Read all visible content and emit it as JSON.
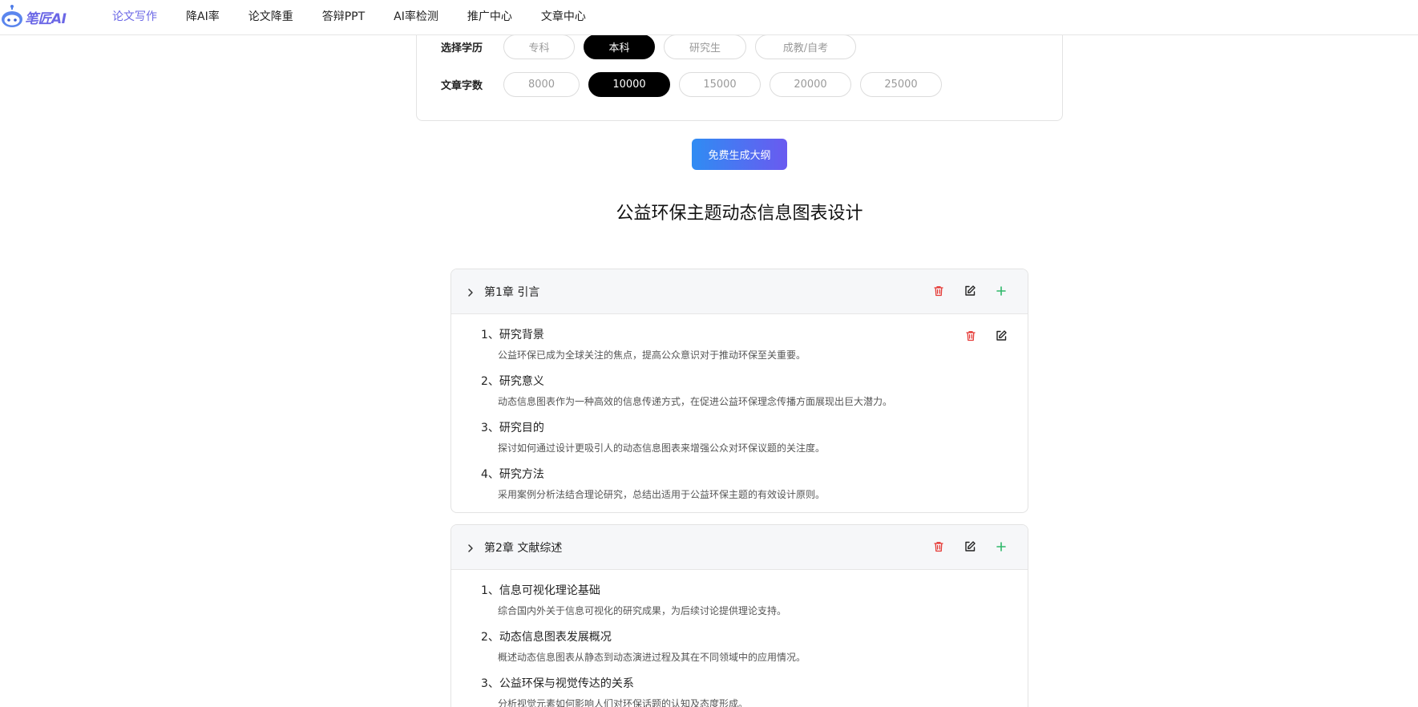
{
  "brand": {
    "name": "笔匠AI"
  },
  "nav": {
    "items": [
      {
        "label": "论文写作",
        "active": true
      },
      {
        "label": "降AI率",
        "active": false
      },
      {
        "label": "论文降重",
        "active": false
      },
      {
        "label": "答辩PPT",
        "active": false
      },
      {
        "label": "AI率检测",
        "active": false
      },
      {
        "label": "推广中心",
        "active": false
      },
      {
        "label": "文章中心",
        "active": false
      }
    ]
  },
  "options": {
    "education": {
      "label": "选择学历",
      "choices": [
        "专科",
        "本科",
        "研究生",
        "成教/自考"
      ],
      "selected": "本科"
    },
    "word_count": {
      "label": "文章字数",
      "choices": [
        "8000",
        "10000",
        "15000",
        "20000",
        "25000"
      ],
      "selected": "10000"
    }
  },
  "generate_button": {
    "label": "免费生成大纲"
  },
  "outline": {
    "title": "公益环保主题动态信息图表设计",
    "chapters": [
      {
        "title": "第1章 引言",
        "sections": [
          {
            "title": "1、研究背景",
            "desc": "公益环保已成为全球关注的焦点，提高公众意识对于推动环保至关重要。"
          },
          {
            "title": "2、研究意义",
            "desc": "动态信息图表作为一种高效的信息传递方式，在促进公益环保理念传播方面展现出巨大潜力。"
          },
          {
            "title": "3、研究目的",
            "desc": "探讨如何通过设计更吸引人的动态信息图表来增强公众对环保议题的关注度。"
          },
          {
            "title": "4、研究方法",
            "desc": "采用案例分析法结合理论研究，总结出适用于公益环保主题的有效设计原则。"
          }
        ]
      },
      {
        "title": "第2章 文献综述",
        "sections": [
          {
            "title": "1、信息可视化理论基础",
            "desc": "综合国内外关于信息可视化的研究成果，为后续讨论提供理论支持。"
          },
          {
            "title": "2、动态信息图表发展概况",
            "desc": "概述动态信息图表从静态到动态演进过程及其在不同领域中的应用情况。"
          },
          {
            "title": "3、公益环保与视觉传达的关系",
            "desc": "分析视觉元素如何影响人们对环保话题的认知及态度形成。"
          }
        ]
      }
    ]
  },
  "colors": {
    "accent": "#6b67e6",
    "delete": "#e53935",
    "add": "#2fb86a",
    "selected_pill": "#000000"
  },
  "icons": {
    "chevron": "chevron-right-icon",
    "delete": "trash-icon",
    "edit": "edit-icon",
    "add": "plus-icon",
    "logo": "robot-logo-icon"
  }
}
